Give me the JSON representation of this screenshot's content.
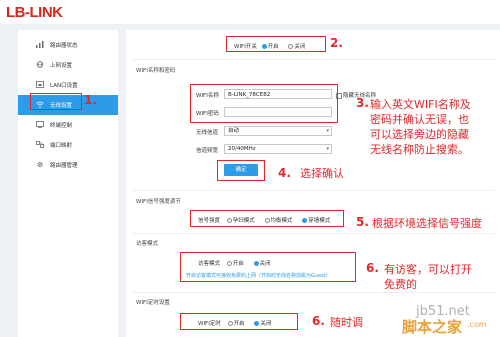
{
  "brand": {
    "logo": "LB-LINK"
  },
  "sidebar": {
    "items": [
      {
        "label": "路由器状态",
        "icon": "status-bars-icon",
        "active": false
      },
      {
        "label": "上网设置",
        "icon": "globe-icon",
        "active": false
      },
      {
        "label": "LAN口设置",
        "icon": "lan-port-icon",
        "active": false
      },
      {
        "label": "无线设置",
        "icon": "wifi-icon",
        "active": true
      },
      {
        "label": "终端控制",
        "icon": "terminal-icon",
        "active": false
      },
      {
        "label": "端口映射",
        "icon": "port-map-icon",
        "active": false
      },
      {
        "label": "路由器管理",
        "icon": "gear-icon",
        "active": false
      }
    ]
  },
  "wifi_switch": {
    "label": "WIFI开关",
    "on": "开启",
    "off": "关闭"
  },
  "wifi_name_section": {
    "title": "WIFI名称和密码",
    "name_label": "WIFI名称",
    "name_value": "B-LINK_78CE82",
    "hide_label": "隐藏无线名称",
    "password_label": "WIFI密码",
    "password_value": "",
    "channel_label": "无线信道",
    "channel_value": "自动",
    "bandwidth_label": "信道频宽",
    "bandwidth_value": "20/40MHz",
    "confirm_label": "确定"
  },
  "signal_section": {
    "title": "WIFI信号强度调节",
    "label": "信号强度",
    "options": [
      "孕妇模式",
      "均衡模式",
      "穿墙模式"
    ]
  },
  "guest_section": {
    "title": "访客模式",
    "label": "访客模式",
    "on": "开启",
    "off": "关闭",
    "hint": "开启访客模式可接收免费的上网（开启时无线名称前缀为Guest）"
  },
  "timer_section": {
    "title": "WIFI定时设置",
    "label": "WIFI定时",
    "on": "开启",
    "off": "关闭"
  },
  "annotations": {
    "step1": "1.",
    "step2": "2.",
    "step3": "3.",
    "step3_text_l1": "输入英文WIFI名称及",
    "step3_text_l2": "密码并确认无误，也",
    "step3_text_l3": "可以选择旁边的隐藏",
    "step3_text_l4": "无线名称防止搜索。",
    "step4": "4.",
    "step4_text": "选择确认",
    "step5": "5.",
    "step5_text": "根据环境选择信号强度",
    "step6a": "6.",
    "step6a_text": "有访客，可以打开",
    "step6a_text_l2": "免费的",
    "step6b": "6.",
    "step6b_text": "随时调"
  },
  "watermark": {
    "site": "jb51.net",
    "name": "脚本之家",
    "domain": ".com"
  },
  "colors": {
    "accent": "#2c9be8",
    "annotation_red": "#e3272b",
    "brand_red": "#d7261e"
  }
}
